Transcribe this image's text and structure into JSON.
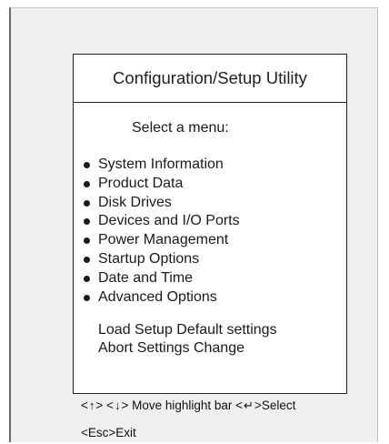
{
  "panel": {
    "title": "Configuration/Setup Utility",
    "prompt": "Select a menu:",
    "menu_items": [
      "System Information",
      "Product Data",
      "Disk Drives",
      "Devices and I/O Ports",
      "Power Management",
      "Startup Options",
      "Date and Time",
      "Advanced Options"
    ],
    "extra_items": [
      "Load Setup Default settings",
      "Abort Settings Change"
    ]
  },
  "footer": {
    "up_open": "<",
    "up_icon": "↑",
    "up_close": ">",
    "down_open": "<",
    "down_icon": "↓",
    "move_text": "> Move highlight bar",
    "enter_open": "<",
    "enter_icon": "↵",
    "select_text": ">Select",
    "exit_text": "<Esc>Exit"
  }
}
